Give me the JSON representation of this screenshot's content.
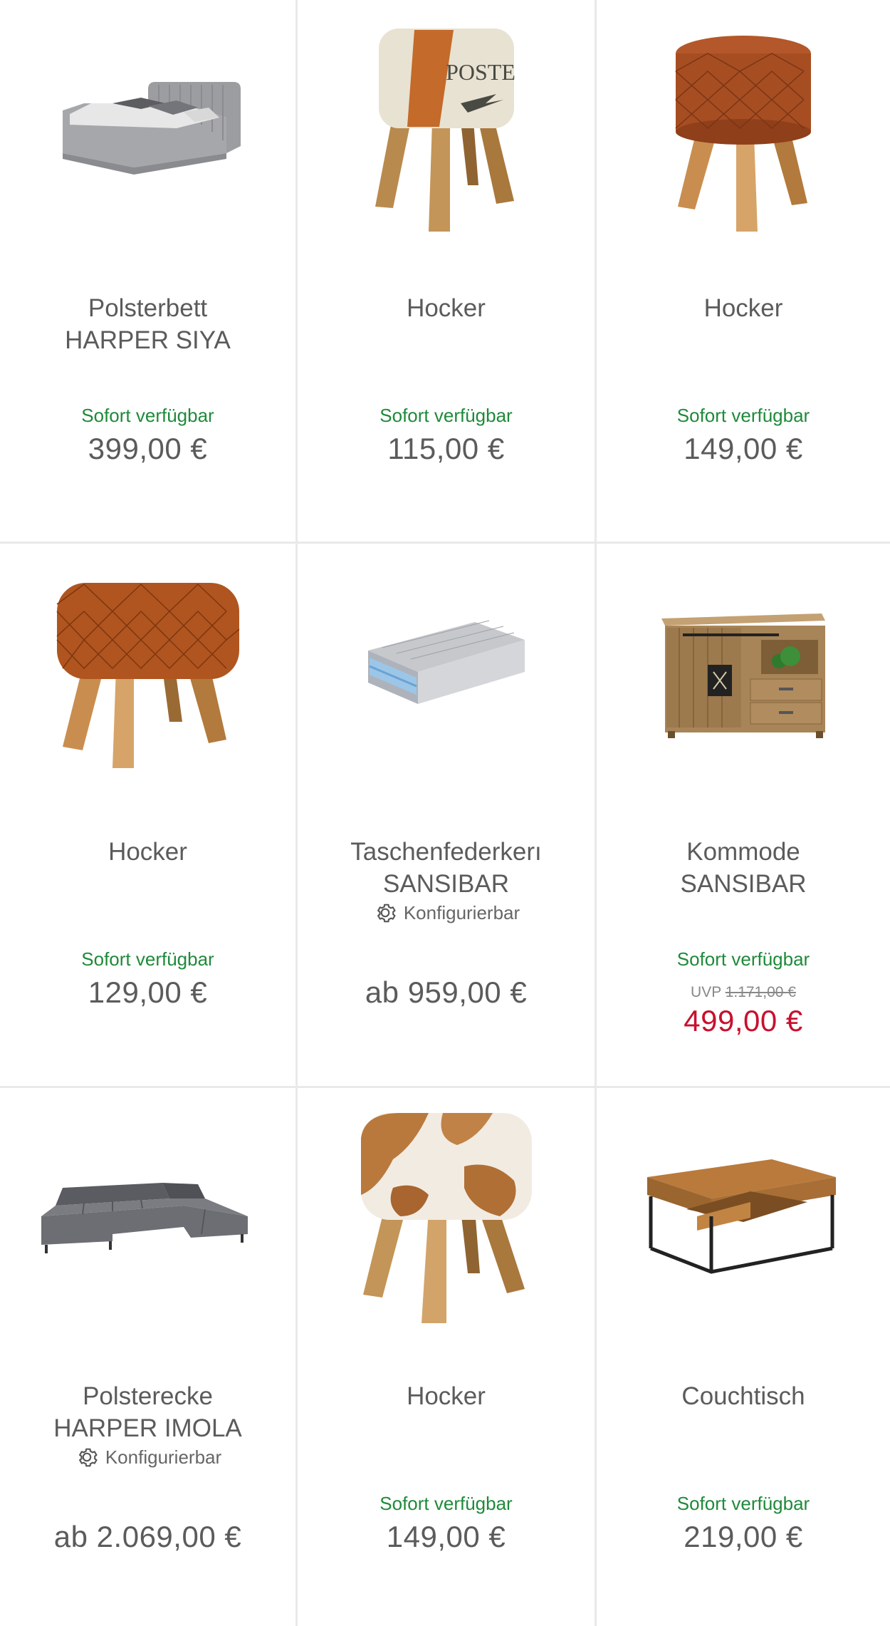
{
  "colors": {
    "availability": "#1f8a3a",
    "sale_price": "#c8102e",
    "divider": "#e9e9e9",
    "text": "#5b5b5b"
  },
  "products": [
    {
      "title": "Polsterbett\nHARPER SIYA",
      "availability": "Sofort verfügbar",
      "price": "399,00 €",
      "image": "bed-image"
    },
    {
      "title": "Hocker",
      "availability": "Sofort verfügbar",
      "price": "115,00 €",
      "image": "poste-stool-image",
      "image_text": "POSTE"
    },
    {
      "title": "Hocker",
      "availability": "Sofort verfügbar",
      "price": "149,00 €",
      "image": "round-leather-stool-image"
    },
    {
      "title": "Hocker",
      "availability": "Sofort verfügbar",
      "price": "129,00 €",
      "image": "quilted-leather-stool-image"
    },
    {
      "title": "Taschenfederkerı\nSANSIBAR",
      "config_label": "Konfigurierbar",
      "config_icon": "gear-icon",
      "price": "ab 959,00 €",
      "image": "mattress-image"
    },
    {
      "title": "Kommode\nSANSIBAR",
      "availability": "Sofort verfügbar",
      "uvp_label": "UVP",
      "uvp_price": "1.171,00 €",
      "price": "499,00 €",
      "image": "sideboard-image"
    },
    {
      "title": "Polsterecke\nHARPER IMOLA",
      "config_label": "Konfigurierbar",
      "config_icon": "gear-icon",
      "price": "ab 2.069,00 €",
      "image": "corner-sofa-image"
    },
    {
      "title": "Hocker",
      "availability": "Sofort verfügbar",
      "price": "149,00 €",
      "image": "cowhide-stool-image"
    },
    {
      "title": "Couchtisch",
      "availability": "Sofort verfügbar",
      "price": "219,00 €",
      "image": "coffee-table-image"
    }
  ]
}
